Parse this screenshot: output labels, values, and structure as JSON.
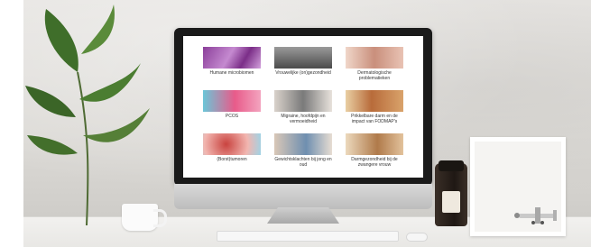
{
  "tiles": [
    {
      "label": "Humane microbiomen",
      "thumb_icon": "microscopy-thumbnail",
      "colors": [
        "#8b3f9a",
        "#c58ad0"
      ]
    },
    {
      "label": "Vrouwelijke (on)gezondheid",
      "thumb_icon": "typewriter-thumbnail",
      "colors": [
        "#4b4b4b",
        "#9a9a9a"
      ]
    },
    {
      "label": "Dermatologische problematieken",
      "thumb_icon": "face-thumbnail",
      "colors": [
        "#c98f7c",
        "#f0d6c9"
      ]
    },
    {
      "label": "PCOS",
      "thumb_icon": "pcos-thumbnail",
      "colors": [
        "#e85b8a",
        "#6bc6d8"
      ]
    },
    {
      "label": "Migraine, hoofdpijn en vermoeidheid",
      "thumb_icon": "headache-thumbnail",
      "colors": [
        "#7a7a7a",
        "#d9d2cb"
      ]
    },
    {
      "label": "Prikkelbare darm en de impact van FODMAP's",
      "thumb_icon": "food-thumbnail",
      "colors": [
        "#b86b3a",
        "#e9cfa3"
      ]
    },
    {
      "label": "(Borst)tumoren",
      "thumb_icon": "cells-thumbnail",
      "colors": [
        "#c9433f",
        "#f2b6b0"
      ]
    },
    {
      "label": "Gewichtsklachten bij jong en oud",
      "thumb_icon": "people-thumbnail",
      "colors": [
        "#6f8fb0",
        "#d9c7b7"
      ]
    },
    {
      "label": "Darmgezondheid bij de zwangere vrouw",
      "thumb_icon": "pregnancy-thumbnail",
      "colors": [
        "#b07a4a",
        "#ecd9bd"
      ]
    }
  ]
}
